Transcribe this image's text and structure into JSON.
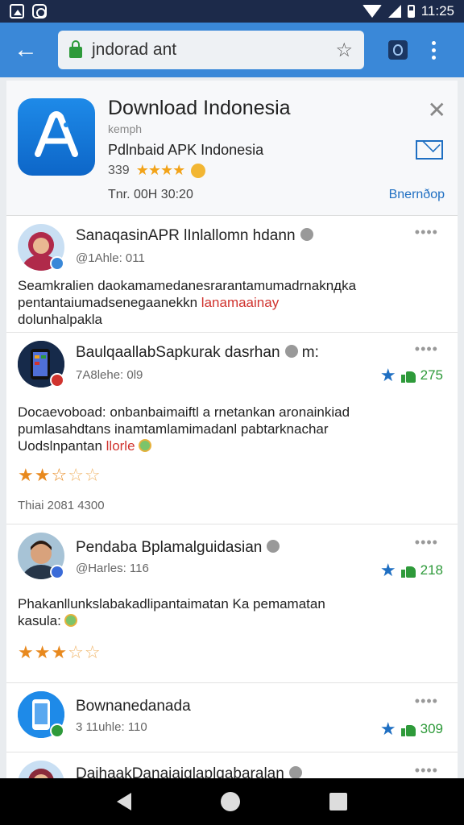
{
  "status_bar": {
    "time": "11:25"
  },
  "browser": {
    "url": "jndorad ant"
  },
  "app": {
    "title": "Download Indonesia",
    "developer": "kemph",
    "subtitle": "Pdlnbaid APK Indonesia",
    "rating_count": "339",
    "date": "Tnr. 00H 30:20",
    "link": "Bnernðop"
  },
  "reviews": [
    {
      "name": "SanaqasinAPR lInlallomn hdann",
      "meta": "@1Ahle: 011",
      "body_lines": [
        "Seamkralien daokamamedanesrarantamumadrnaknдka",
        "pentantaiumadsenegaanekkn "
      ],
      "body_highlight": "lanamaainay",
      "body_tail": "dolunhalpakla",
      "votes": ""
    },
    {
      "name": "BaulqaallabSapkurak dasrhan",
      "name_suffix": "m:",
      "meta": "7A8lehe: 0l9",
      "votes": "275",
      "body_lines": [
        "Docaevoboad: onbanbaimaiftl a rnetankan aronainkiad",
        "pumlasahdtans inamtamlamimadanl pabtarknachar"
      ],
      "body_prefix": "Uodslnpantan ",
      "body_highlight": "llorle",
      "stars": 2.5,
      "date": "Thiai 2081 4300"
    },
    {
      "name": "Pendaba Bplamalguidasian",
      "meta": "@Harles: 116",
      "votes": "218",
      "body_lines": [
        "Phakanllunkslabakadlipantaimatan Ka pemamatan",
        "kasula:"
      ],
      "stars": 3
    },
    {
      "name": "Bownanedanada",
      "meta": "3 11uhle: 110",
      "votes": "309"
    },
    {
      "name": "DaihaakDanaiaiglaplqabaralan"
    }
  ]
}
